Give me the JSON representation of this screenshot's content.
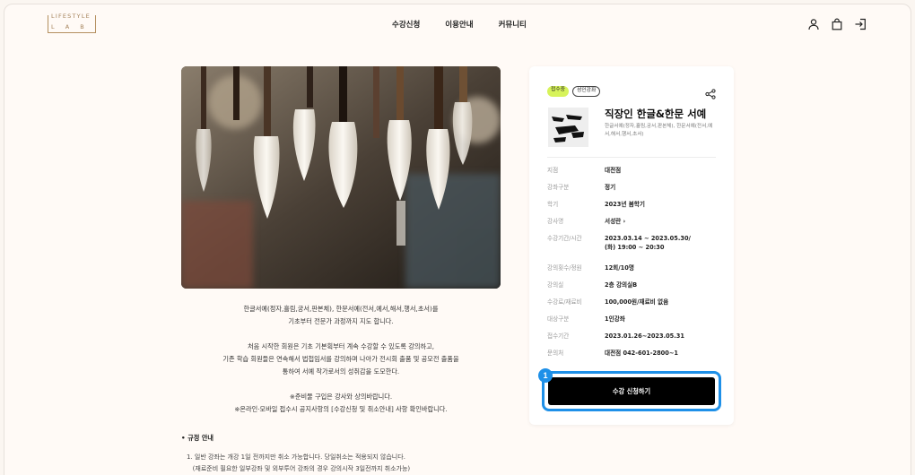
{
  "header": {
    "logo_top": "LIFESTYLE",
    "logo_bottom": "LAB",
    "nav": [
      "수강신청",
      "이용안내",
      "커뮤니티"
    ],
    "icons": [
      "user-icon",
      "shopping-bag-icon",
      "login-icon"
    ]
  },
  "description": [
    "한글서예(정자,흘림,궁서,판본체), 한문서예(전서,예서,해서,행서,초서)를",
    "기초부터 전문가 과정까지 지도 합니다.",
    "",
    "처음 시작한 회원은 기초 기본획부터 계속 수강할 수 있도록 강의하고,",
    "기존 학습 회원들은 연속해서 법첩임서를 강의하며 나아가 전시회 출품 및 공모전 출품을",
    "통하여 서예 작가로서의 성취감을 도모한다.",
    "",
    "※준비물 구입은 강사와 상의바랍니다.",
    "※온라인·모바일 접수시 공지사항의 [수강신청 및 취소안내] 사항 확인바랍니다."
  ],
  "rules": {
    "title": "•  규정 안내",
    "items": [
      "1. 일반 강좌는 개강 1일 전까지만 취소 가능합니다. 당일취소는 적용되지 않습니다.",
      "   (재료준비 필요한 일부강좌 및 외부투어 강좌의 경우 강의시작 3일전까지 취소가능)"
    ]
  },
  "card": {
    "badge_status": "접수중",
    "badge_type": "성인강좌",
    "title": "직장인 한글&한문 서예",
    "subtitle": "한글서예(정자,흘림,궁서,판본체), 한문서예(전서,예서,해서,행서,초서)",
    "rows": [
      {
        "k": "지점",
        "v": "대전점"
      },
      {
        "k": "강좌구분",
        "v": "정기"
      },
      {
        "k": "학기",
        "v": "2023년 봄학기"
      },
      {
        "k": "강사명",
        "v": "서성란 ›"
      },
      {
        "k": "수강기간/시간",
        "v": "2023.03.14 ~ 2023.05.30/",
        "v2": "(화) 19:00 ~ 20:30"
      },
      {
        "k": "강의횟수/정원",
        "v": "12회/10명"
      },
      {
        "k": "강의실",
        "v": "2층 강의실B"
      },
      {
        "k": "수강료/재료비",
        "v": "100,000원/재료비 없음"
      },
      {
        "k": "대상구분",
        "v": "1인강좌"
      },
      {
        "k": "접수기간",
        "v": "2023.01.26~2023.05.31"
      },
      {
        "k": "문의처",
        "v": "대전점 042-601-2800~1"
      }
    ],
    "cta": "수강 신청하기",
    "marker": "1"
  },
  "colors": {
    "accent": "#1e90e8",
    "badge": "#d7f35a",
    "logo": "#a4825a"
  }
}
